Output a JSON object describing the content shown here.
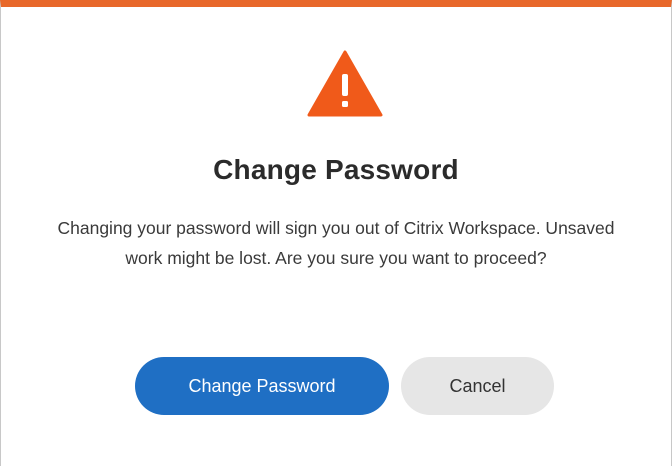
{
  "dialog": {
    "title": "Change Password",
    "message": "Changing your password will sign you out of Citrix Workspace. Unsaved work might be lost. Are you sure you want to proceed?",
    "icon": "warning-icon",
    "accent_color": "#e8682a",
    "primary_button_label": "Change Password",
    "primary_button_color": "#1f6fc4",
    "secondary_button_label": "Cancel"
  }
}
